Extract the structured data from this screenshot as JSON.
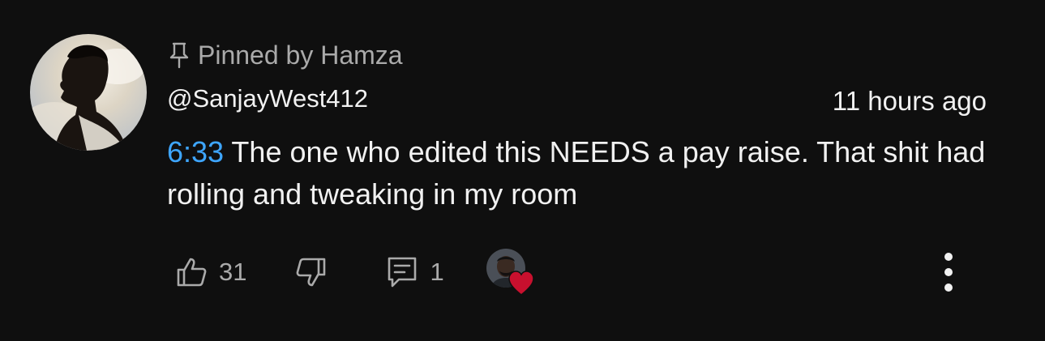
{
  "comment": {
    "pinned_label": "Pinned by Hamza",
    "author": "@SanjayWest412",
    "timestamp": "11 hours ago",
    "timecode": "6:33",
    "text": " The one who edited this NEEDS a pay raise. That shit had rolling and tweaking in my room",
    "like_count": "31",
    "reply_count": "1"
  },
  "icons": {
    "pin": "pin-icon",
    "like": "thumbs-up-icon",
    "dislike": "thumbs-down-icon",
    "reply": "comment-reply-icon",
    "heart": "heart-icon",
    "more": "vertical-ellipsis-icon"
  },
  "colors": {
    "background": "#0f0f0f",
    "primary_text": "#f1f1f1",
    "secondary_text": "#aaaaaa",
    "timecode_link": "#3ea6ff",
    "heart": "#c8102e"
  }
}
